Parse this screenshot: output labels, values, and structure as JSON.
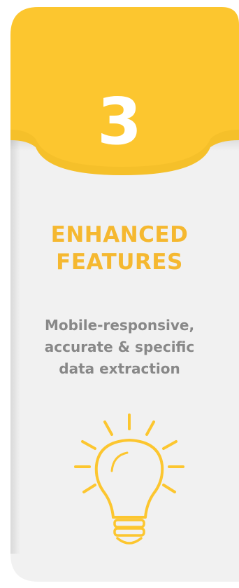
{
  "card": {
    "number": "3",
    "title": "ENHANCED\nFEATURES",
    "description": "Mobile-responsive,\naccurate & specific\ndata extraction",
    "icon": "lightbulb-icon"
  },
  "colors": {
    "accent": "#fcc62f",
    "accent_shadow": "#b8901f",
    "title": "#f5b830",
    "text": "#888888",
    "card_body": "#f1f1f1",
    "number": "#ffffff"
  }
}
